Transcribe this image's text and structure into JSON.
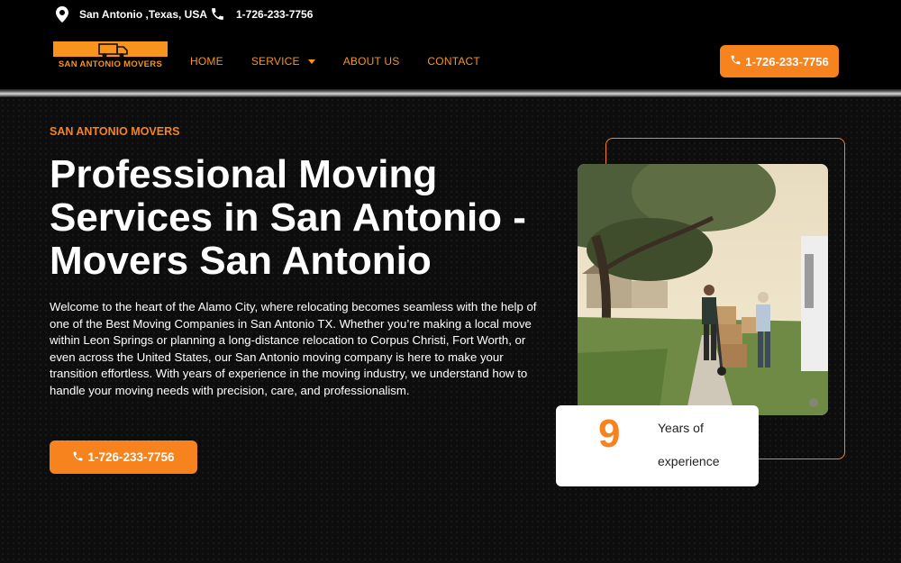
{
  "topbar": {
    "location": "San Antonio ,Texas, USA",
    "phone": "1-726-233-7756"
  },
  "header": {
    "logo_text": "SAN ANTONIO MOVERS",
    "nav": [
      {
        "label": "HOME"
      },
      {
        "label": "SERVICE"
      },
      {
        "label": "ABOUT US"
      },
      {
        "label": "CONTACT"
      }
    ],
    "phone_button": "1-726-233-7756"
  },
  "hero": {
    "eyebrow": "SAN ANTONIO MOVERS",
    "title": "Professional Moving Services in San Antonio - Movers San Antonio",
    "description": "Welcome to the heart of the Alamo City, where relocating becomes seamless with the help of one of the Best Moving Companies in San Antonio TX. Whether you’re making a local move within Leon Springs or planning a long-distance relocation to Corpus Christi, Fort Worth, or even across the United States, our San Antonio moving company is here to make your transition effortless. With years of experience in the moving industry, we understand how to handle your moving needs with precision, care, and professionalism.",
    "cta_phone": "1-726-233-7756"
  },
  "experience": {
    "number": "9",
    "line1": "Years of",
    "line2": "experience"
  },
  "colors": {
    "accent": "#f7831f",
    "background": "#0d0d0d"
  },
  "icons": {
    "location": "map-pin-icon",
    "phone": "phone-icon",
    "caret": "chevron-down-icon"
  }
}
